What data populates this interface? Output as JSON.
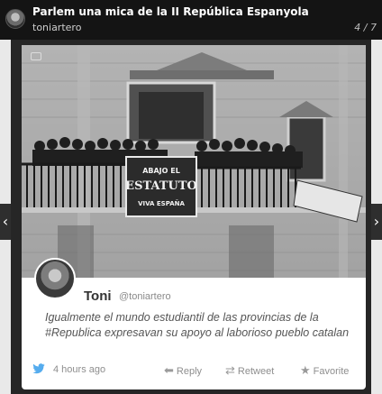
{
  "header": {
    "title": "Parlem una mica de la II República Espanyola",
    "username": "toniartero",
    "counter": "4 / 7"
  },
  "photo": {
    "banner_line1": "ABAJO EL",
    "banner_line2": "ESTATUTO",
    "banner_line3": "VIVA ESPAÑA"
  },
  "tweet": {
    "name": "Toni",
    "handle": "@toniartero",
    "text": "Igualmente el mundo estudiantil de las provincias de la #Republica expresavan su apoyo al laborioso pueblo catalan",
    "time": "4 hours ago",
    "reply": "Reply",
    "retweet": "Retweet",
    "favorite": "Favorite"
  },
  "colors": {
    "twitter_blue": "#55acee"
  }
}
